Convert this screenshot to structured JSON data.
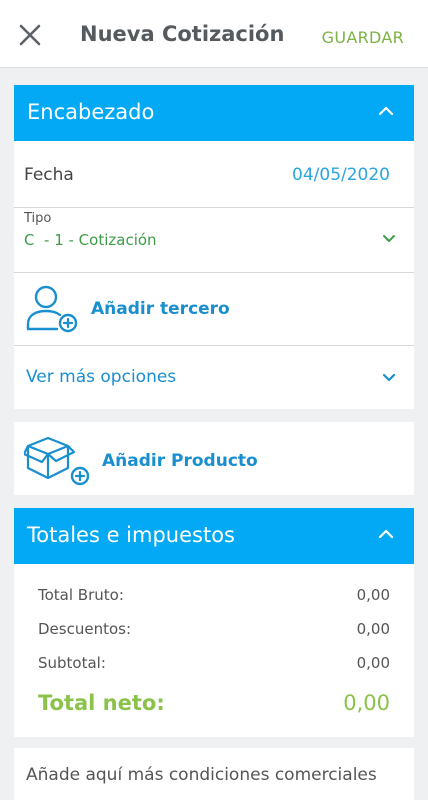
{
  "header": {
    "close_icon": "close-icon",
    "title": "Nueva Cotización",
    "save_label": "GUARDAR"
  },
  "encabezado": {
    "title": "Encabezado",
    "fecha_label": "Fecha",
    "fecha_value": "04/05/2020",
    "tipo_label": "Tipo",
    "tipo_value": "C  - 1 - Cotización",
    "add_third_label": "Añadir tercero",
    "more_options_label": "Ver más opciones"
  },
  "producto": {
    "add_product_label": "Añadir Producto"
  },
  "totales": {
    "title": "Totales e impuestos",
    "rows": [
      {
        "label": "Total Bruto:",
        "value": "0,00"
      },
      {
        "label": "Descuentos:",
        "value": "0,00"
      },
      {
        "label": "Subtotal:",
        "value": "0,00"
      }
    ],
    "net_label": "Total neto:",
    "net_value": "0,00"
  },
  "condiciones": {
    "label": "Añade aquí más condiciones comerciales"
  },
  "colors": {
    "primary_blue": "#03a9f4",
    "link_blue": "#1a8fcf",
    "accent_green": "#8bc34a",
    "tipo_green": "#3d9d47"
  }
}
